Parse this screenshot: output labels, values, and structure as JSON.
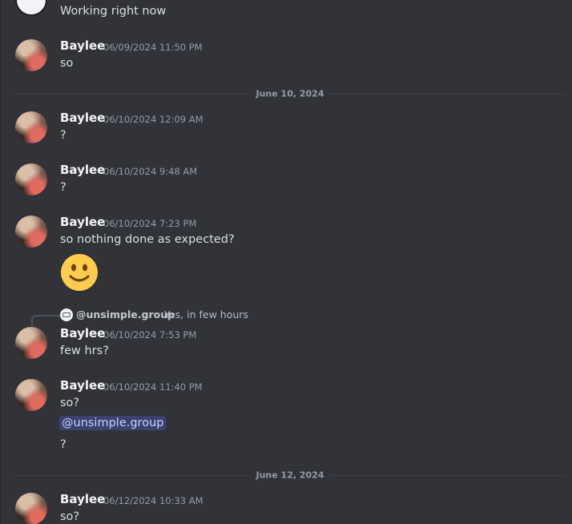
{
  "channel": {
    "messages": [
      {
        "content": "Working right now"
      },
      {
        "author": "Baylee",
        "timestamp": "06/09/2024 11:50 PM",
        "content": "so"
      },
      {
        "author": "Baylee",
        "timestamp": "06/10/2024 12:09 AM",
        "content": "?"
      },
      {
        "author": "Baylee",
        "timestamp": "06/10/2024 9:48 AM",
        "content": "?"
      },
      {
        "author": "Baylee",
        "timestamp": "06/10/2024 7:23 PM",
        "content": "so nothing done as expected?",
        "emoji": "slightly-smiling-face"
      },
      {
        "author": "Baylee",
        "timestamp": "06/10/2024 7:53 PM",
        "content": "few hrs?",
        "reply": {
          "author": "@unsimple.group",
          "text": "Yes, in few hours"
        }
      },
      {
        "author": "Baylee",
        "timestamp": "06/10/2024 11:40 PM",
        "content": "so?",
        "mention": "@unsimple.group",
        "content2": "?"
      },
      {
        "author": "Baylee",
        "timestamp": "06/12/2024 10:33 AM",
        "content": "so?"
      }
    ],
    "dividers": [
      "June 10, 2024",
      "June 12, 2024"
    ]
  },
  "colors": {
    "background": "#313338",
    "author": "#f2f3f5",
    "timestamp": "#949ba4",
    "mention_bg": "#3c4270",
    "mention_fg": "#c9cdfb"
  }
}
